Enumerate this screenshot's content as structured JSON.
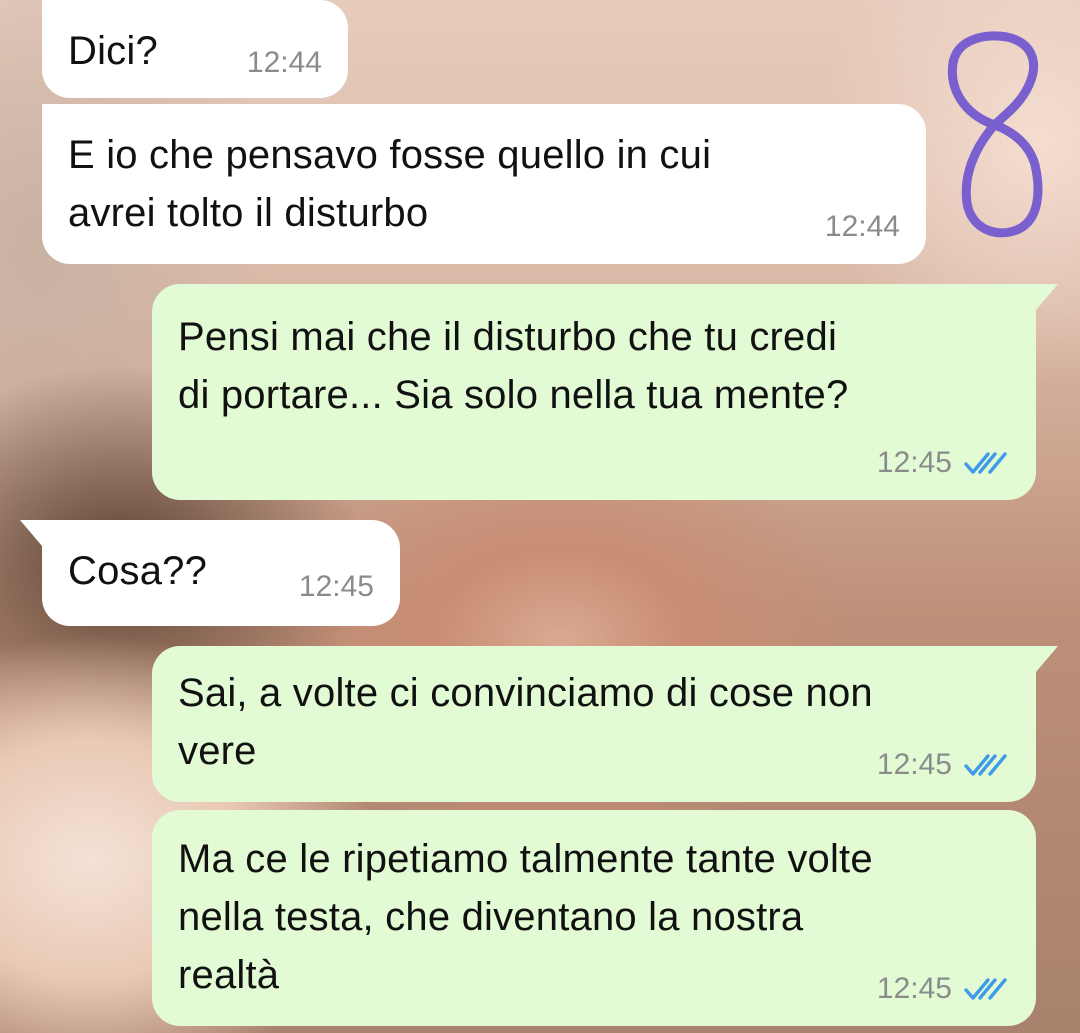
{
  "chat": {
    "messages": [
      {
        "direction": "in",
        "text": "Dici?",
        "time": "12:44"
      },
      {
        "direction": "in",
        "text": "E io che pensavo fosse quello in cui\navrei tolto il disturbo",
        "time": "12:44"
      },
      {
        "direction": "out",
        "text": "Pensi mai che il disturbo che tu credi\ndi portare... Sia solo nella tua mente?",
        "time": "12:45",
        "status": "read"
      },
      {
        "direction": "in",
        "text": "Cosa??",
        "time": "12:45"
      },
      {
        "direction": "out",
        "text": "Sai, a volte ci convinciamo di cose non\nvere",
        "time": "12:45",
        "status": "read"
      },
      {
        "direction": "out",
        "text": "Ma ce le ripetiamo talmente tante volte\nnella testa, che diventano la nostra\nrealtà",
        "time": "12:45",
        "status": "read"
      }
    ]
  },
  "annotation": {
    "label": "8",
    "color": "#7a5fcf"
  },
  "colors": {
    "incoming_bubble": "#ffffff",
    "outgoing_bubble": "#e3fbd4",
    "timestamp": "#8b8b8b",
    "read_ticks": "#3d9be9"
  },
  "icons": {
    "read_status": "double-check-icon"
  }
}
